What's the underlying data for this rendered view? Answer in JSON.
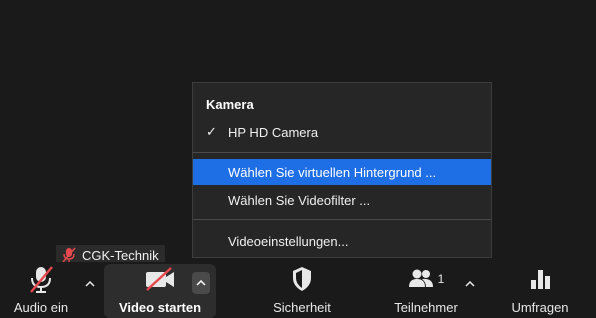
{
  "name_tag": {
    "label": "CGK-Technik"
  },
  "camera_menu": {
    "header": "Kamera",
    "cameras": [
      {
        "label": "HP HD Camera",
        "checked": true
      }
    ],
    "items": [
      {
        "label": "Wählen Sie virtuellen Hintergrund ...",
        "selected": true
      },
      {
        "label": "Wählen Sie Videofilter ...",
        "selected": false
      }
    ],
    "settings_label": "Videoeinstellungen..."
  },
  "toolbar": {
    "audio_label": "Audio ein",
    "video_label": "Video starten",
    "security_label": "Sicherheit",
    "participants_label": "Teilnehmer",
    "participants_count": "1",
    "polls_label": "Umfragen"
  },
  "colors": {
    "accent": "#1e6ee6",
    "muted_red": "#e5484d",
    "background": "#1a1a1a",
    "menu_bg": "#262626"
  }
}
